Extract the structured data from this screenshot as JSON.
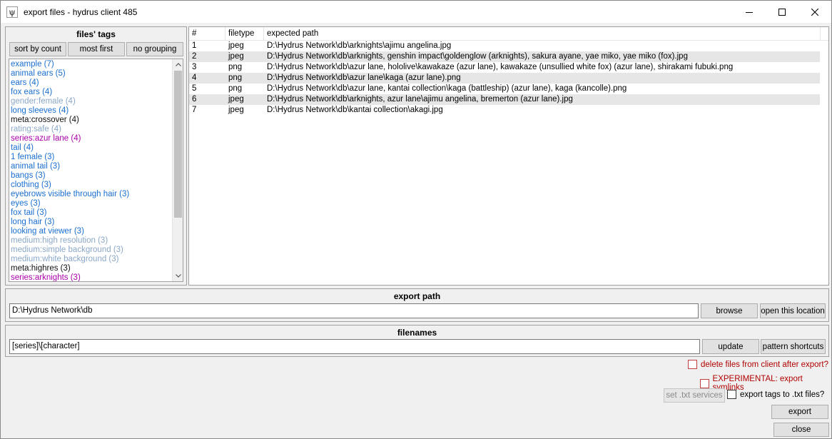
{
  "window": {
    "title": "export files - hydrus client 485",
    "app_icon_glyph": "ψ"
  },
  "tags_panel": {
    "title": "files' tags",
    "sort_by_count": "sort by count",
    "most_first": "most first",
    "no_grouping": "no grouping",
    "tags": [
      {
        "text": "example (7)",
        "color": "#1a6fd0"
      },
      {
        "text": "animal ears (5)",
        "color": "#1a6fd0"
      },
      {
        "text": "ears (4)",
        "color": "#1a6fd0"
      },
      {
        "text": "fox ears (4)",
        "color": "#1a6fd0"
      },
      {
        "text": "gender:female (4)",
        "color": "#8aa7c7"
      },
      {
        "text": "long sleeves (4)",
        "color": "#1a6fd0"
      },
      {
        "text": "meta:crossover (4)",
        "color": "#111111"
      },
      {
        "text": "rating:safe (4)",
        "color": "#8aa7c7"
      },
      {
        "text": "series:azur lane (4)",
        "color": "#aa00aa"
      },
      {
        "text": "tail (4)",
        "color": "#1a6fd0"
      },
      {
        "text": "1 female (3)",
        "color": "#1a6fd0"
      },
      {
        "text": "animal tail (3)",
        "color": "#1a6fd0"
      },
      {
        "text": "bangs (3)",
        "color": "#1a6fd0"
      },
      {
        "text": "clothing (3)",
        "color": "#1a6fd0"
      },
      {
        "text": "eyebrows visible through hair (3)",
        "color": "#1a6fd0"
      },
      {
        "text": "eyes (3)",
        "color": "#1a6fd0"
      },
      {
        "text": "fox tail (3)",
        "color": "#1a6fd0"
      },
      {
        "text": "long hair (3)",
        "color": "#1a6fd0"
      },
      {
        "text": "looking at viewer (3)",
        "color": "#1a6fd0"
      },
      {
        "text": "medium:high resolution (3)",
        "color": "#8aa7c7"
      },
      {
        "text": "medium:simple background (3)",
        "color": "#8aa7c7"
      },
      {
        "text": "medium:white background (3)",
        "color": "#8aa7c7"
      },
      {
        "text": "meta:highres (3)",
        "color": "#111111"
      },
      {
        "text": "series:arknights (3)",
        "color": "#aa00aa"
      }
    ]
  },
  "file_table": {
    "headers": [
      "#",
      "filetype",
      "expected path"
    ],
    "rows": [
      {
        "num": "1",
        "type": "jpeg",
        "path": "D:\\Hydrus Network\\db\\arknights\\ajimu angelina.jpg"
      },
      {
        "num": "2",
        "type": "jpeg",
        "path": "D:\\Hydrus Network\\db\\arknights, genshin impact\\goldenglow (arknights), sakura ayane, yae miko, yae miko (fox).jpg"
      },
      {
        "num": "3",
        "type": "png",
        "path": "D:\\Hydrus Network\\db\\azur lane, hololive\\kawakaze (azur lane), kawakaze (unsullied white fox) (azur lane), shirakami fubuki.png"
      },
      {
        "num": "4",
        "type": "png",
        "path": "D:\\Hydrus Network\\db\\azur lane\\kaga (azur lane).png"
      },
      {
        "num": "5",
        "type": "png",
        "path": "D:\\Hydrus Network\\db\\azur lane, kantai collection\\kaga (battleship) (azur lane), kaga (kancolle).png"
      },
      {
        "num": "6",
        "type": "jpeg",
        "path": "D:\\Hydrus Network\\db\\arknights, azur lane\\ajimu angelina, bremerton (azur lane).jpg"
      },
      {
        "num": "7",
        "type": "jpeg",
        "path": "D:\\Hydrus Network\\db\\kantai collection\\akagi.jpg"
      }
    ]
  },
  "export_path": {
    "title": "export path",
    "value": "D:\\Hydrus Network\\db",
    "browse": "browse",
    "open_location": "open this location"
  },
  "filenames": {
    "title": "filenames",
    "value": "[series]\\[character]",
    "update": "update",
    "pattern_shortcuts": "pattern shortcuts"
  },
  "options": {
    "delete_files": "delete files from client after export?",
    "symlinks": "EXPERIMENTAL: export symlinks",
    "set_txt_services": "set .txt services",
    "export_tags_txt": "export tags to .txt files?"
  },
  "actions": {
    "export": "export",
    "close": "close"
  }
}
